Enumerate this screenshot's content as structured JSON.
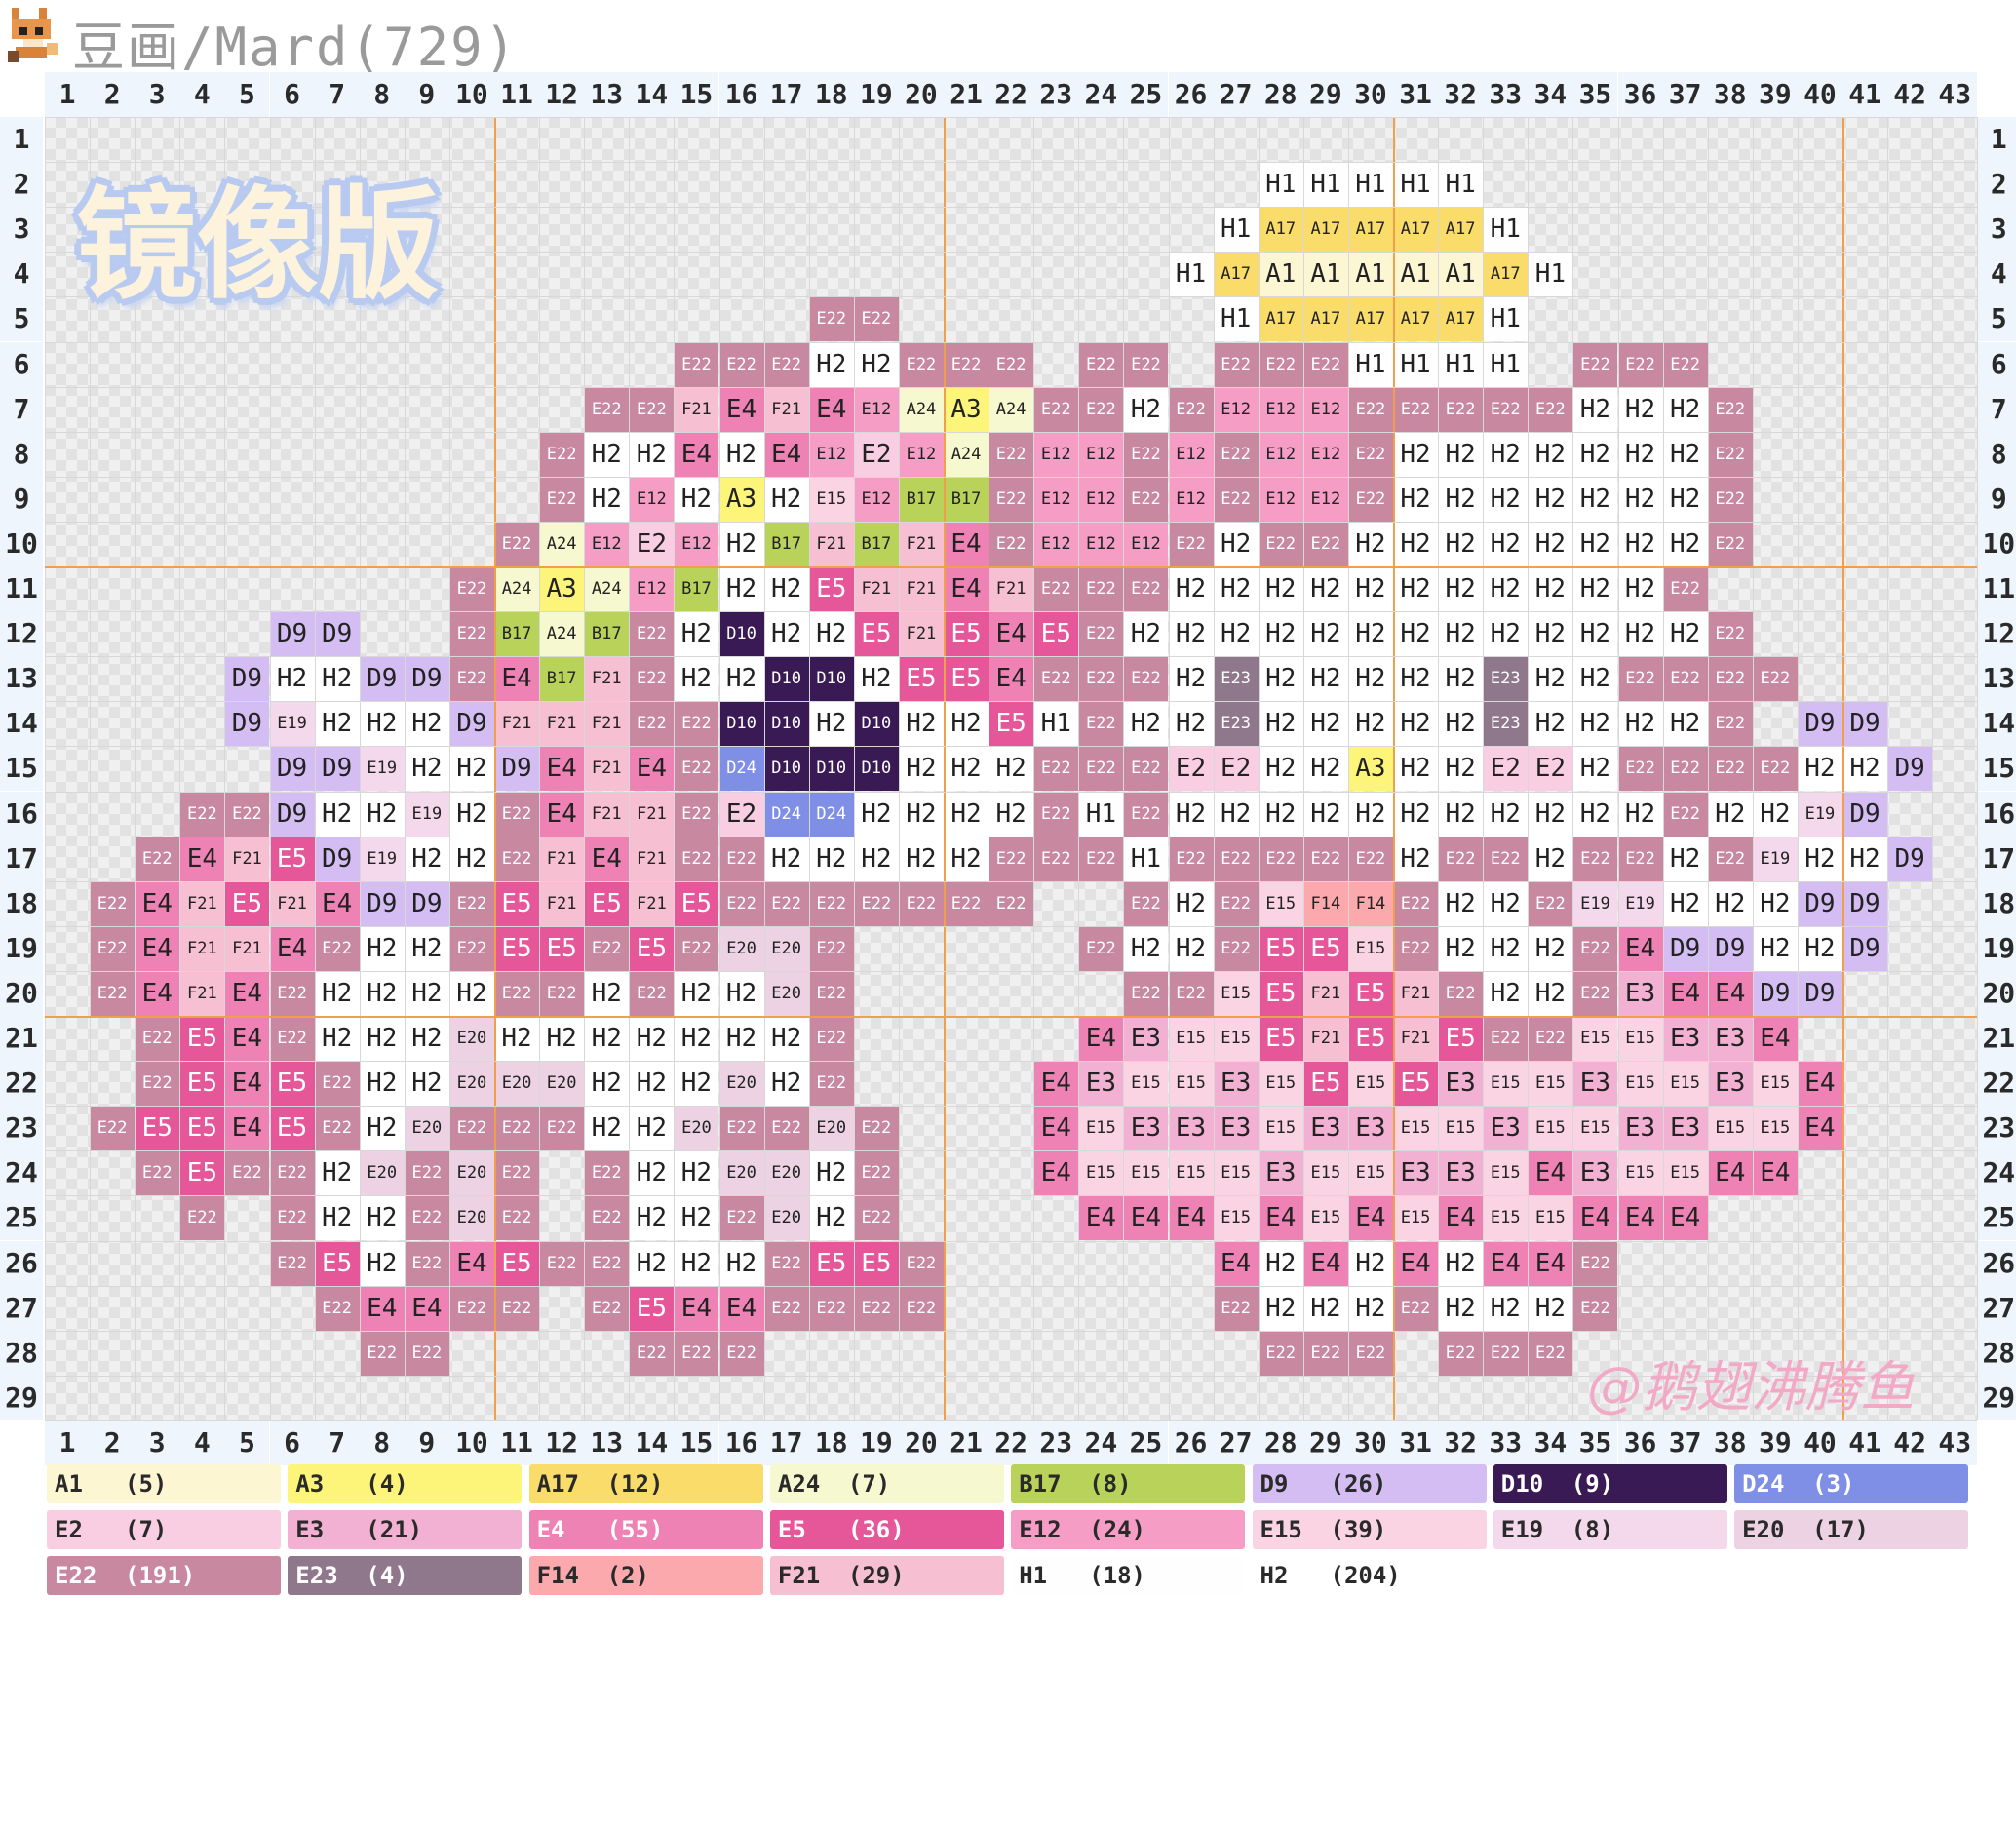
{
  "header": {
    "title": "豆画/Mard(729)",
    "logo_icon": "pixel-fox-icon"
  },
  "watermark": "镜像版",
  "signature": "@鹅翅沸腾鱼",
  "grid": {
    "cols": 43,
    "rows": 29,
    "col_labels": [
      "1",
      "2",
      "3",
      "4",
      "5",
      "6",
      "7",
      "8",
      "9",
      "10",
      "11",
      "12",
      "13",
      "14",
      "15",
      "16",
      "17",
      "18",
      "19",
      "20",
      "21",
      "22",
      "23",
      "24",
      "25",
      "26",
      "27",
      "28",
      "29",
      "30",
      "31",
      "32",
      "33",
      "34",
      "35",
      "36",
      "37",
      "38",
      "39",
      "40",
      "41",
      "42",
      "43"
    ],
    "row_labels": [
      "1",
      "2",
      "3",
      "4",
      "5",
      "6",
      "7",
      "8",
      "9",
      "10",
      "11",
      "12",
      "13",
      "14",
      "15",
      "16",
      "17",
      "18",
      "19",
      "20",
      "21",
      "22",
      "23",
      "24",
      "25",
      "26",
      "27",
      "28",
      "29"
    ],
    "cells": [
      "",
      "28:H1 29:H1 30:H1 31:H1 32:H1",
      "27:H1 28:A17 29:A17 30:A17 31:A17 32:A17 33:H1",
      "26:H1 27:A17 28:A1 29:A1 30:A1 31:A1 32:A1 33:A17 34:H1",
      "18:E22 19:E22 27:H1 28:A17 29:A17 30:A17 31:A17 32:A17 33:H1",
      "15:E22 16:E22 17:E22 18:H2 19:H2 20:E22 21:E22 22:E22 24:E22 25:E22 27:E22 28:E22 29:E22 30:H1 31:H1 32:H1 33:H1 35:E22 36:E22 37:E22",
      "13:E22 14:E22 15:F21 16:E4 17:F21 18:E4 19:E12 20:A24 21:A3 22:A24 23:E22 24:E22 25:H2 26:E22 27:E12 28:E12 29:E12 30:E22 31:E22 32:E22 33:E22 34:E22 35:H2 36:H2 37:H2 38:E22",
      "12:E22 13:H2 14:H2 15:E4 16:H2 17:E4 18:E12 19:E2 20:E12 21:A24 22:E22 23:E12 24:E12 25:E22 26:E12 27:E22 28:E12 29:E12 30:E22 31:H2 32:H2 33:H2 34:H2 35:H2 36:H2 37:H2 38:E22",
      "12:E22 13:H2 14:E12 15:H2 16:A3 17:H2 18:E15 19:E12 20:B17 21:B17 22:E22 23:E12 24:E12 25:E22 26:E12 27:E22 28:E12 29:E12 30:E22 31:H2 32:H2 33:H2 34:H2 35:H2 36:H2 37:H2 38:E22",
      "11:E22 12:A24 13:E12 14:E2 15:E12 16:H2 17:B17 18:F21 19:B17 20:F21 21:E4 22:E22 23:E12 24:E12 25:E12 26:E22 27:H2 28:E22 29:E22 30:H2 31:H2 32:H2 33:H2 34:H2 35:H2 36:H2 37:H2 38:E22",
      "10:E22 11:A24 12:A3 13:A24 14:E12 15:B17 16:H2 17:H2 18:E5 19:F21 20:F21 21:E4 22:F21 23:E22 24:E22 25:E22 26:H2 27:H2 28:H2 29:H2 30:H2 31:H2 32:H2 33:H2 34:H2 35:H2 36:H2 37:E22",
      "6:D9 7:D9 10:E22 11:B17 12:A24 13:B17 14:E22 15:H2 16:D10 17:H2 18:H2 19:E5 20:F21 21:E5 22:E4 23:E5 24:E22 25:H2 26:H2 27:H2 28:H2 29:H2 30:H2 31:H2 32:H2 33:H2 34:H2 35:H2 36:H2 37:H2 38:E22",
      "5:D9 6:H2 7:H2 8:D9 9:D9 10:E22 11:E4 12:B17 13:F21 14:E22 15:H2 16:H2 17:D10 18:D10 19:H2 20:E5 21:E5 22:E4 23:E22 24:E22 25:E22 26:H2 27:E23 28:H2 29:H2 30:H2 31:H2 32:H2 33:E23 34:H2 35:H2 36:E22 37:E22 38:E22 39:E22",
      "5:D9 6:E19 7:H2 8:H2 9:H2 10:D9 11:F21 12:F21 13:F21 14:E22 15:E22 16:D10 17:D10 18:H2 19:D10 20:H2 21:H2 22:E5 23:H1 24:E22 25:H2 26:H2 27:E23 28:H2 29:H2 30:H2 31:H2 32:H2 33:E23 34:H2 35:H2 36:H2 37:H2 38:E22 40:D9 41:D9",
      "6:D9 7:D9 8:E19 9:H2 10:H2 11:D9 12:E4 13:F21 14:E4 15:E22 16:D24 17:D10 18:D10 19:D10 20:H2 21:H2 22:H2 23:E22 24:E22 25:E22 26:E2 27:E2 28:H2 29:H2 30:A3 31:H2 32:H2 33:E2 34:E2 35:H2 36:E22 37:E22 38:E22 39:E22 40:H2 41:H2 42:D9",
      "4:E22 5:E22 6:D9 7:H2 8:H2 9:E19 10:H2 11:E22 12:E4 13:F21 14:F21 15:E22 16:E2 17:D24 18:D24 19:H2 20:H2 21:H2 22:H2 23:E22 24:H1 25:E22 26:H2 27:H2 28:H2 29:H2 30:H2 31:H2 32:H2 33:H2 34:H2 35:H2 36:H2 37:E22 38:H2 39:H2 40:E19 41:D9",
      "3:E22 4:E4 5:F21 6:E5 7:D9 8:E19 9:H2 10:H2 11:E22 12:F21 13:E4 14:F21 15:E22 16:E22 17:H2 18:H2 19:H2 20:H2 21:H2 22:E22 23:E22 24:E22 25:H1 26:E22 27:E22 28:E22 29:E22 30:E22 31:H2 32:E22 33:E22 34:H2 35:E22 36:E22 37:H2 38:E22 39:E19 40:H2 41:H2 42:D9",
      "2:E22 3:E4 4:F21 5:E5 6:F21 7:E4 8:D9 9:D9 10:E22 11:E5 12:F21 13:E5 14:F21 15:E5 16:E22 17:E22 18:E22 19:E22 20:E22 21:E22 22:E22 25:E22 26:H2 27:E22 28:E15 29:F14 30:F14 31:E22 32:H2 33:H2 34:E22 35:E19 36:E19 37:H2 38:H2 39:H2 40:D9 41:D9",
      "2:E22 3:E4 4:F21 5:F21 6:E4 7:E22 8:H2 9:H2 10:E22 11:E5 12:E5 13:E22 14:E5 15:E22 16:E20 17:E20 18:E22 24:E22 25:H2 26:H2 27:E22 28:E5 29:E5 30:E15 31:E22 32:H2 33:H2 34:H2 35:E22 36:E4 37:D9 38:D9 39:H2 40:H2 41:D9",
      "2:E22 3:E4 4:F21 5:E4 6:E22 7:H2 8:H2 9:H2 10:H2 11:E22 12:E22 13:H2 14:E22 15:H2 16:H2 17:E20 18:E22 25:E22 26:E22 27:E15 28:E5 29:F21 30:E5 31:F21 32:E22 33:H2 34:H2 35:E22 36:E3 37:E4 38:E4 39:D9 40:D9",
      "3:E22 4:E5 5:E4 6:E22 7:H2 8:H2 9:H2 10:E20 11:H2 12:H2 13:H2 14:H2 15:H2 16:H2 17:H2 18:E22 24:E4 25:E3 26:E15 27:E15 28:E5 29:F21 30:E5 31:F21 32:E5 33:E22 34:E22 35:E15 36:E15 37:E3 38:E3 39:E4",
      "3:E22 4:E5 5:E4 6:E5 7:E22 8:H2 9:H2 10:E20 11:E20 12:E20 13:H2 14:H2 15:H2 16:E20 17:H2 18:E22 23:E4 24:E3 25:E15 26:E15 27:E3 28:E15 29:E5 30:E15 31:E5 32:E3 33:E15 34:E15 35:E3 36:E15 37:E15 38:E3 39:E15 40:E4",
      "2:E22 3:E5 4:E5 5:E4 6:E5 7:E22 8:H2 9:E20 10:E22 11:E22 12:E22 13:H2 14:H2 15:E20 16:E22 17:E22 18:E20 19:E22 23:E4 24:E15 25:E3 26:E3 27:E3 28:E15 29:E3 30:E3 31:E15 32:E15 33:E3 34:E15 35:E15 36:E3 37:E3 38:E15 39:E15 40:E4",
      "3:E22 4:E5 5:E22 6:E22 7:H2 8:E20 9:E22 10:E20 11:E22 13:E22 14:H2 15:H2 16:E20 17:E20 18:H2 19:E22 23:E4 24:E15 25:E15 26:E15 27:E15 28:E3 29:E15 30:E15 31:E3 32:E3 33:E15 34:E4 35:E3 36:E15 37:E15 38:E4 39:E4",
      "4:E22 6:E22 7:H2 8:H2 9:E22 10:E20 11:E22 13:E22 14:H2 15:H2 16:E22 17:E20 18:H2 19:E22 24:E4 25:E4 26:E4 27:E15 28:E4 29:E15 30:E4 31:E15 32:E4 33:E15 34:E15 35:E4 36:E4 37:E4",
      "6:E22 7:E5 8:H2 9:E22 10:E4 11:E5 12:E22 13:E22 14:H2 15:H2 16:H2 17:E22 18:E5 19:E5 20:E22 27:E4 28:H2 29:E4 30:H2 31:E4 32:H2 33:E4 34:E4 35:E22",
      "7:E22 8:E4 9:E4 10:E22 11:E22 13:E22 14:E5 15:E4 16:E4 17:E22 18:E22 19:E22 20:E22 27:E22 28:H2 29:H2 30:H2 31:E22 32:H2 33:H2 34:H2 35:E22",
      "8:E22 9:E22 14:E22 15:E22 16:E22 28:E22 29:E22 30:E22 32:E22 33:E22 34:E22",
      ""
    ]
  },
  "palette": {
    "A1": "#fdf6d2",
    "A3": "#fdf57a",
    "A17": "#f9dc6a",
    "A24": "#f6f9cf",
    "B17": "#b9d25a",
    "D9": "#d3bdf2",
    "D10": "#3a1a55",
    "D24": "#7f8fe6",
    "E2": "#f9cee2",
    "E3": "#f2b0d3",
    "E4": "#ef82b4",
    "E5": "#e6579a",
    "E12": "#f69dc6",
    "E15": "#fbd4e3",
    "E19": "#f4d8ec",
    "E20": "#ecd2e3",
    "E22": "#c8889f",
    "E23": "#90788c",
    "F14": "#fba9ad",
    "F21": "#f6bfd2",
    "H1": "#fefefe",
    "H2": "#ffffff"
  },
  "legend": [
    {
      "code": "A1",
      "count": "(5)"
    },
    {
      "code": "A3",
      "count": "(4)"
    },
    {
      "code": "A17",
      "count": "(12)"
    },
    {
      "code": "A24",
      "count": "(7)"
    },
    {
      "code": "B17",
      "count": "(8)"
    },
    {
      "code": "D9",
      "count": "(26)"
    },
    {
      "code": "D10",
      "count": "(9)"
    },
    {
      "code": "D24",
      "count": "(3)"
    },
    {
      "code": "E2",
      "count": "(7)"
    },
    {
      "code": "E3",
      "count": "(21)"
    },
    {
      "code": "E4",
      "count": "(55)"
    },
    {
      "code": "E5",
      "count": "(36)"
    },
    {
      "code": "E12",
      "count": "(24)"
    },
    {
      "code": "E15",
      "count": "(39)"
    },
    {
      "code": "E19",
      "count": "(8)"
    },
    {
      "code": "E20",
      "count": "(17)"
    },
    {
      "code": "E22",
      "count": "(191)"
    },
    {
      "code": "E23",
      "count": "(4)"
    },
    {
      "code": "F14",
      "count": "(2)"
    },
    {
      "code": "F21",
      "count": "(29)"
    },
    {
      "code": "H1",
      "count": "(18)"
    },
    {
      "code": "H2",
      "count": "(204)"
    }
  ]
}
